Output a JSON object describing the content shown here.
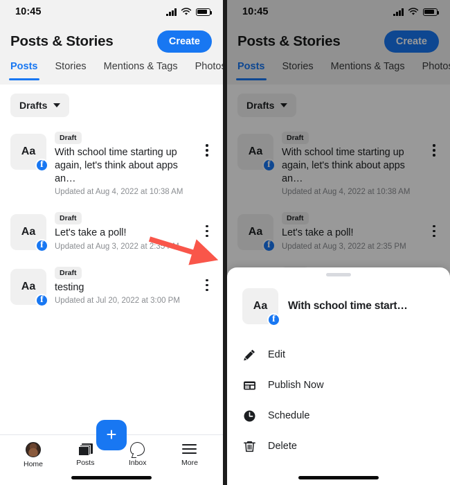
{
  "status_bar": {
    "time": "10:45",
    "signal_icon": "cellular-signal-icon",
    "wifi_icon": "wifi-icon",
    "battery_icon": "battery-icon"
  },
  "header": {
    "title": "Posts & Stories",
    "create_label": "Create"
  },
  "tabs": [
    {
      "label": "Posts",
      "active": true
    },
    {
      "label": "Stories",
      "active": false
    },
    {
      "label": "Mentions & Tags",
      "active": false
    },
    {
      "label": "Photos",
      "active": false
    }
  ],
  "filter_chip": {
    "label": "Drafts",
    "caret_icon": "chevron-down-icon"
  },
  "drafts": [
    {
      "thumb_text": "Aa",
      "badge": "Draft",
      "title": "With school time starting up again, let's think about apps an…",
      "meta": "Updated at Aug 4, 2022 at 10:38 AM"
    },
    {
      "thumb_text": "Aa",
      "badge": "Draft",
      "title": "Let's take a poll!",
      "meta": "Updated at Aug 3, 2022 at 2:35 PM"
    },
    {
      "thumb_text": "Aa",
      "badge": "Draft",
      "title": "testing",
      "meta": "Updated at Jul 20, 2022 at 3:00 PM"
    }
  ],
  "bottom_nav": {
    "items": [
      {
        "label": "Home",
        "icon": "avatar-icon"
      },
      {
        "label": "Posts",
        "icon": "posts-icon"
      },
      {
        "label": "Inbox",
        "icon": "inbox-icon"
      },
      {
        "label": "More",
        "icon": "hamburger-icon"
      }
    ],
    "fab": {
      "label": "+",
      "icon": "plus-icon"
    }
  },
  "sheet": {
    "grabber_icon": "drag-handle-icon",
    "thumb_text": "Aa",
    "title": "With school time start…",
    "items": [
      {
        "label": "Edit",
        "icon": "pencil-icon"
      },
      {
        "label": "Publish Now",
        "icon": "publish-card-icon"
      },
      {
        "label": "Schedule",
        "icon": "clock-icon"
      },
      {
        "label": "Delete",
        "icon": "trash-icon"
      }
    ]
  },
  "annotation": {
    "arrow_icon": "red-arrow-annotation",
    "color": "#f9564a"
  },
  "colors": {
    "accent": "#1877f2",
    "chrome_bg": "#f2f2f2",
    "text_primary": "#1c1e21",
    "text_muted": "#8a8d91",
    "overlay": "rgba(0,0,0,0.40)"
  }
}
